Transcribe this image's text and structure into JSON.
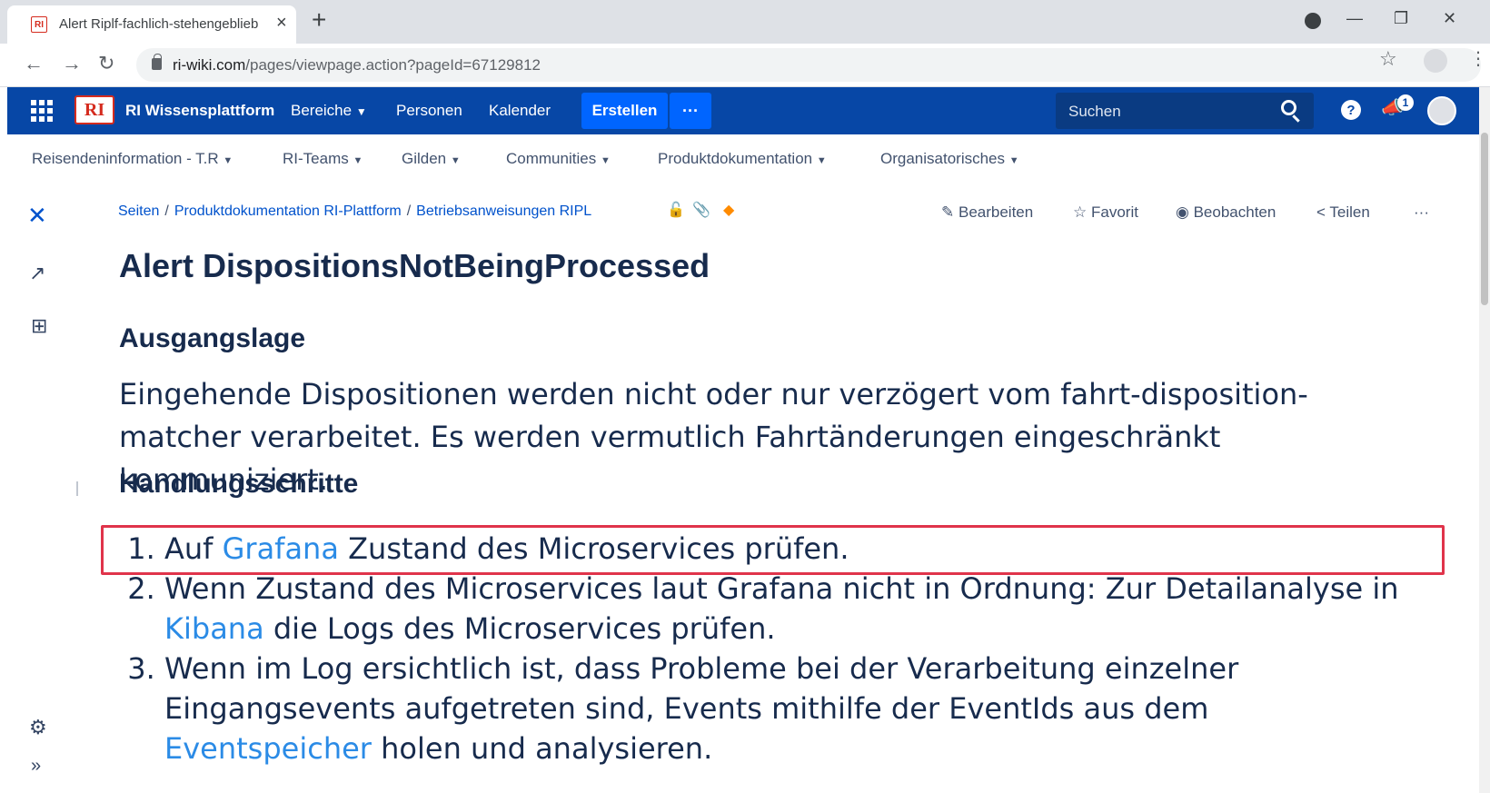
{
  "browser": {
    "tab_title": "Alert Riplf-fachlich-stehengeblieb",
    "tab_favicon": "RI",
    "new_tab": "+",
    "url_host": "ri-wiki.com",
    "url_path": "/pages/viewpage.action?pageId=67129812"
  },
  "header": {
    "logo_text": "RI",
    "site_name": "RI Wissensplattform",
    "nav": [
      "Bereiche",
      "Personen",
      "Kalender"
    ],
    "create_label": "Erstellen",
    "more_label": "···",
    "search_placeholder": "Suchen",
    "help_label": "?",
    "notification_count": "1",
    "brand_color": "#0747a6",
    "create_color": "#0065ff"
  },
  "spacenav": {
    "items": [
      "Reisendeninformation - T.R",
      "RI-Teams",
      "Gilden",
      "Communities",
      "Produktdokumentation",
      "Organisatorisches"
    ]
  },
  "breadcrumb": {
    "items": [
      "Seiten",
      "Produktdokumentation RI-Plattform",
      "Betriebsanweisungen RIPL"
    ]
  },
  "actions": {
    "edit": "Bearbeiten",
    "favorite": "Favorit",
    "watch": "Beobachten",
    "share": "Teilen",
    "more": "···"
  },
  "page": {
    "title": "Alert DispositionsNotBeingProcessed",
    "section1_heading": "Ausgangslage",
    "section1_text": "Eingehende Dispositionen werden nicht oder nur verzögert vom fahrt-disposition-matcher verarbeitet. Es werden vermutlich Fahrtänderungen eingeschränkt kommuniziert.",
    "section2_heading": "Handlungsschritte",
    "steps": [
      {
        "pre": "Auf ",
        "link": "Grafana",
        "post": " Zustand des Microservices prüfen."
      },
      {
        "pre": "Wenn Zustand des Microservices laut Grafana nicht in Ordnung: Zur Detailanalyse in ",
        "link": "Kibana",
        "post": " die Logs des Microservices prüfen."
      },
      {
        "pre": "Wenn im Log ersichtlich ist, dass Probleme bei der Verarbeitung einzelner Eingangsevents aufgetreten sind, Events mithilfe der EventIds aus dem ",
        "link": "Eventspeicher",
        "post": " holen und analysieren."
      }
    ],
    "link_color": "#2b8be6",
    "highlight_color": "#e0344b"
  }
}
